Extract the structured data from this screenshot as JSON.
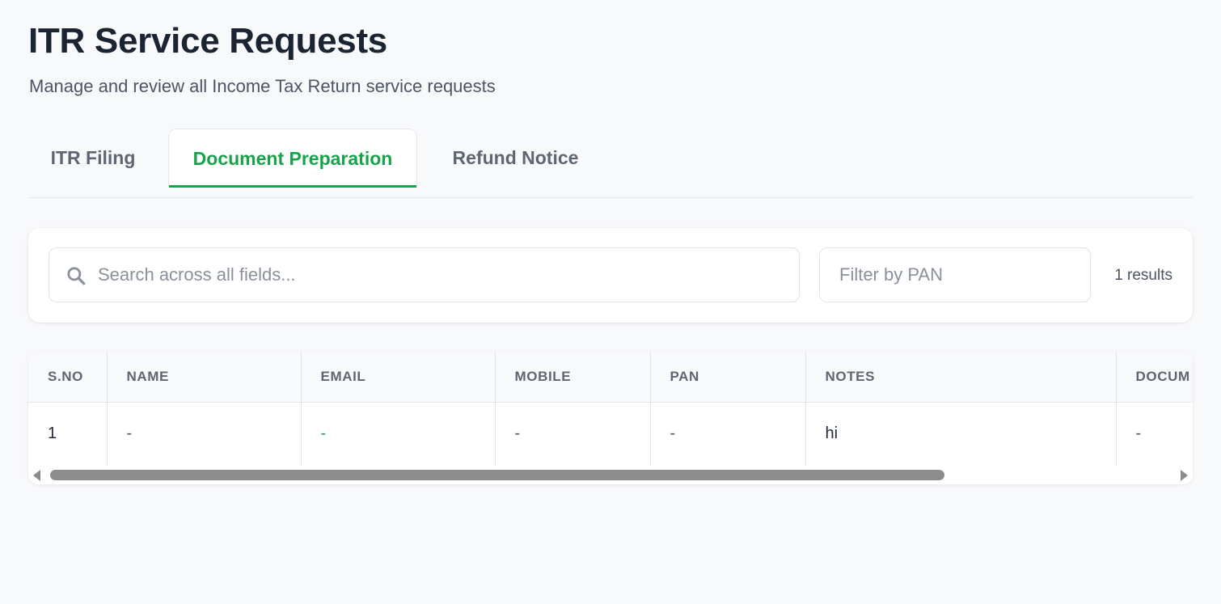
{
  "header": {
    "title": "ITR Service Requests",
    "subtitle": "Manage and review all Income Tax Return service requests"
  },
  "tabs": [
    {
      "label": "ITR Filing",
      "active": false
    },
    {
      "label": "Document Preparation",
      "active": true
    },
    {
      "label": "Refund Notice",
      "active": false
    }
  ],
  "filters": {
    "search_placeholder": "Search across all fields...",
    "search_icon": "search-icon",
    "pan_placeholder": "Filter by PAN",
    "results": "1 results"
  },
  "table": {
    "columns": [
      "S.NO",
      "NAME",
      "EMAIL",
      "MOBILE",
      "PAN",
      "NOTES",
      "DOCUM"
    ],
    "rows": [
      [
        "1",
        "-",
        "-",
        "-",
        "-",
        "hi",
        "-"
      ]
    ]
  },
  "colors": {
    "accent": "#16a34a",
    "title": "#1b2433",
    "background": "#f8f9fb"
  }
}
